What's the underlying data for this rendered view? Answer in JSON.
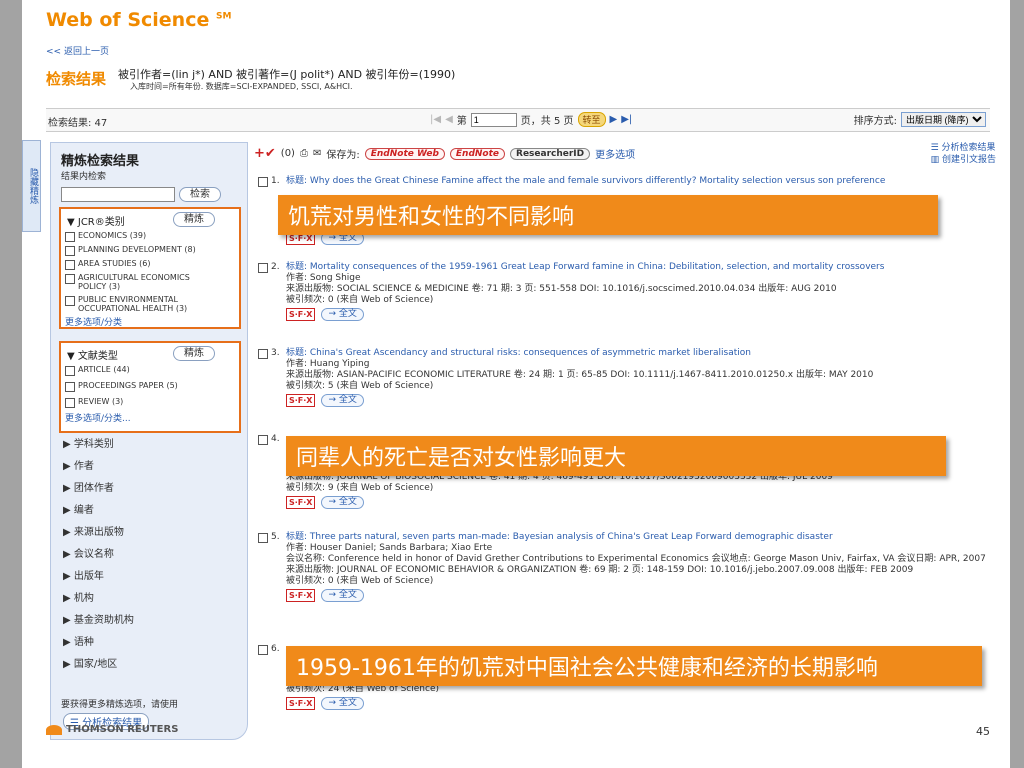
{
  "header": {
    "logo": "Web of Science",
    "logo_sup": "SM",
    "back_link": "<< 返回上一页",
    "results_title": "检索结果",
    "query": "被引作者=(lin j*) AND 被引著作=(J polit*) AND 被引年份=(1990)",
    "query_sub": "入库时间=所有年份. 数据库=SCI-EXPANDED, SSCI, A&HCI."
  },
  "results_bar": {
    "count_label": "检索结果: 47",
    "page_prefix": "第",
    "page_value": "1",
    "page_suffix": "页，共 5 页",
    "goto_label": "转至",
    "sort_label": "排序方式:",
    "sort_value": "出版日期 (降序)"
  },
  "side_tab": "隐藏精炼",
  "refine": {
    "title": "精炼检索结果",
    "search_within": "结果内检索",
    "search_btn": "检索",
    "refine_btn": "精炼",
    "jcr": {
      "title": "▼ JCR®类别",
      "items": [
        "ECONOMICS (39)",
        "PLANNING DEVELOPMENT (8)",
        "AREA STUDIES (6)",
        "AGRICULTURAL ECONOMICS POLICY (3)",
        "PUBLIC ENVIRONMENTAL OCCUPATIONAL HEALTH (3)"
      ],
      "more": "更多选项/分类"
    },
    "doctype": {
      "title": "▼ 文献类型",
      "items": [
        "ARTICLE (44)",
        "PROCEEDINGS PAPER (5)",
        "REVIEW (3)"
      ],
      "more": "更多选项/分类..."
    },
    "categories": [
      "▶ 学科类别",
      "▶ 作者",
      "▶ 团体作者",
      "▶ 编者",
      "▶ 来源出版物",
      "▶ 会议名称",
      "▶ 出版年",
      "▶ 机构",
      "▶ 基金资助机构",
      "▶ 语种",
      "▶ 国家/地区"
    ],
    "hint": "要获得更多精炼选项，请使用",
    "analyze": "☰ 分析检索结果"
  },
  "tools": {
    "count": "(0)",
    "save_to": "保存为:",
    "endnote_web": "EndNote Web",
    "endnote": "EndNote",
    "researcherid": "ResearcherID",
    "more": "更多选项",
    "analyze": "分析检索结果",
    "citation_report": "创建引文报告"
  },
  "records": [
    {
      "num": "1.",
      "title": "标题: Why does the Great Chinese Famine affect the male and female survivors differently? Mortality selection versus son preference",
      "lines": []
    },
    {
      "num": "2.",
      "title": "标题: Mortality consequences of the 1959-1961 Great Leap Forward famine in China: Debilitation, selection, and mortality crossovers",
      "lines": [
        "作者: Song Shige",
        "来源出版物: SOCIAL SCIENCE & MEDICINE 卷: 71 期: 3 页: 551-558 DOI: 10.1016/j.socscimed.2010.04.034 出版年: AUG 2010",
        "被引频次: 0 (来自 Web of Science)"
      ]
    },
    {
      "num": "3.",
      "title": "标题: China's Great Ascendancy and structural risks: consequences of asymmetric market liberalisation",
      "lines": [
        "作者: Huang Yiping",
        "来源出版物: ASIAN-PACIFIC ECONOMIC LITERATURE 卷: 24 期: 1 页: 65-85 DOI: 10.1111/j.1467-8411.2010.01250.x 出版年: MAY 2010",
        "被引频次: 5 (来自 Web of Science)"
      ]
    },
    {
      "num": "4.",
      "title": "",
      "lines": [
        "来源出版物: JOURNAL OF BIOSOCIAL SCIENCE 卷: 41 期: 4 页: 469-491 DOI: 10.1017/S0021932009003332 出版年: JUL 2009",
        "被引频次: 9 (来自 Web of Science)"
      ]
    },
    {
      "num": "5.",
      "title": "标题: Three parts natural, seven parts man-made: Bayesian analysis of China's Great Leap Forward demographic disaster",
      "lines": [
        "作者: Houser Daniel; Sands Barbara; Xiao Erte",
        "会议名称: Conference held in honor of David Grether Contributions to Experimental Economics 会议地点: George Mason Univ, Fairfax, VA 会议日期: APR, 2007",
        "来源出版物: JOURNAL OF ECONOMIC BEHAVIOR & ORGANIZATION 卷: 69 期: 2 页: 148-159 DOI: 10.1016/j.jebo.2007.09.008 出版年: FEB 2009",
        "被引频次: 0 (来自 Web of Science)"
      ]
    },
    {
      "num": "6.",
      "title": "",
      "lines": [
        "被引频次: 24 (来自 Web of Science)"
      ]
    }
  ],
  "sfx_label": "S·F·X",
  "fulltext_label": "→ 全文",
  "banners": [
    "饥荒对男性和女性的不同影响",
    "同辈人的死亡是否对女性影响更大",
    "1959-1961年的饥荒对中国社会公共健康和经济的长期影响"
  ],
  "footer": {
    "brand": "THOMSON REUTERS",
    "page_number": "45"
  },
  "colors": {
    "accent": "#f08a1a",
    "link": "#2a5cad",
    "facet_border": "#e66f1a"
  }
}
